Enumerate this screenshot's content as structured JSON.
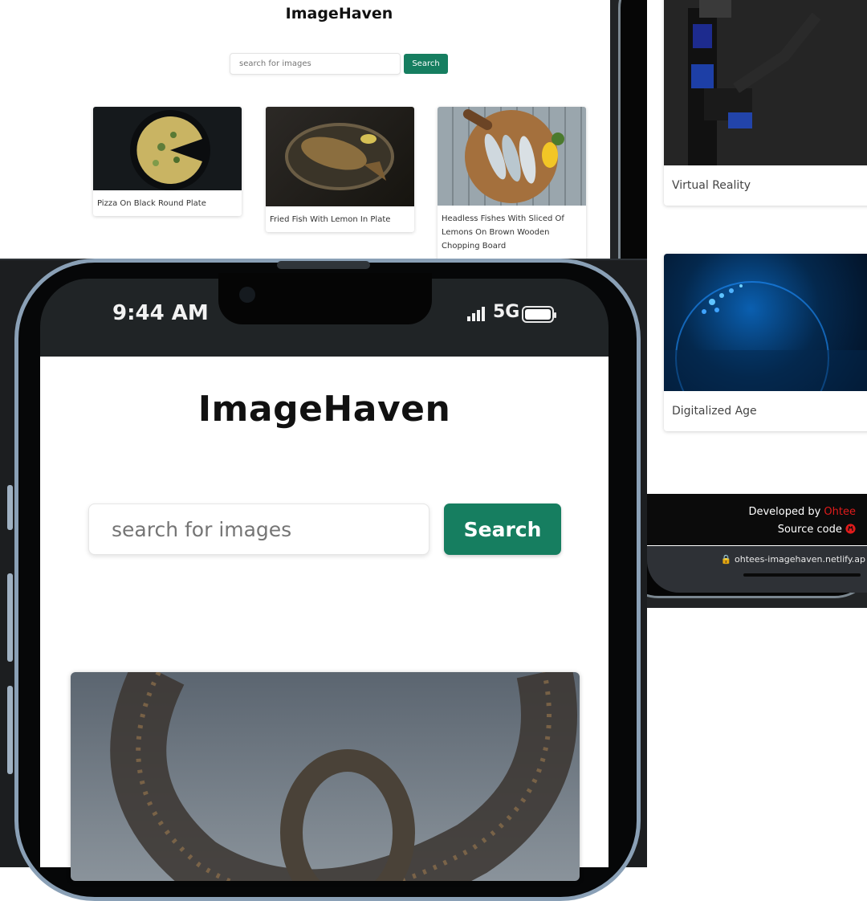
{
  "desktop": {
    "title": "ImageHaven",
    "search_placeholder": "search for images",
    "search_button": "Search",
    "cards": [
      {
        "caption": "Pizza On Black Round Plate"
      },
      {
        "caption": "Fried Fish With Lemon In Plate"
      },
      {
        "caption": "Headless Fishes With Sliced Of Lemons On Brown Wooden Chopping Board"
      }
    ]
  },
  "mobile": {
    "cards": [
      {
        "caption": "Virtual Reality"
      },
      {
        "caption": "Digitalized Age"
      }
    ],
    "footer": {
      "developed_prefix": "Developed by ",
      "developer_name": "Ohtee",
      "source_label": "Source code"
    },
    "url": "ohtees-imagehaven.netlify.ap"
  },
  "phone": {
    "status": {
      "time": "9:44 AM",
      "network": "5G"
    },
    "title": "ImageHaven",
    "search_placeholder": "search for images",
    "search_button": "Search"
  },
  "colors": {
    "accent": "#167e60",
    "developer": "#e01b1b"
  }
}
